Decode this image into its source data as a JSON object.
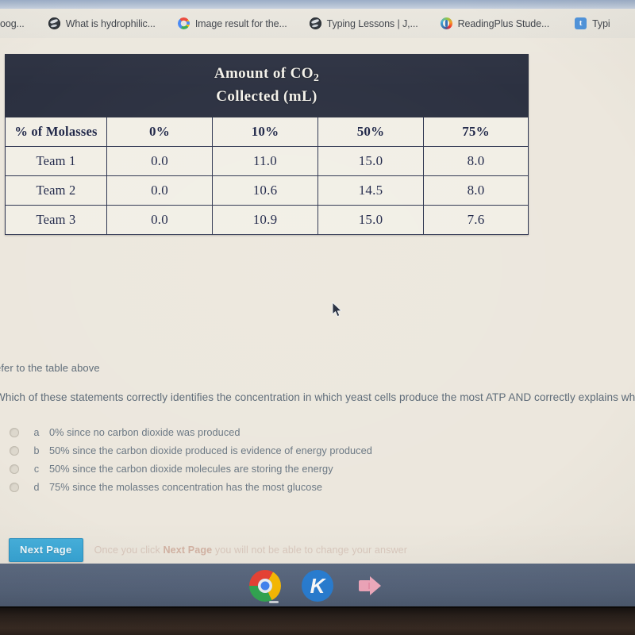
{
  "browser": {
    "bookmarks": [
      {
        "label": "oog...",
        "icon": "globe-icon"
      },
      {
        "label": "What is hydrophilic...",
        "icon": "globe-icon"
      },
      {
        "label": "Image result for the...",
        "icon": "google-g-icon"
      },
      {
        "label": "Typing Lessons | J,...",
        "icon": "globe-icon"
      },
      {
        "label": "ReadingPlus Stude...",
        "icon": "readingplus-icon"
      },
      {
        "label": "Typi",
        "icon": "typing-t-icon"
      }
    ]
  },
  "table": {
    "title_line1": "Amount of CO",
    "title_sub": "2",
    "title_line2": "Collected (mL)",
    "header": [
      "% of Molasses",
      "0%",
      "10%",
      "50%",
      "75%"
    ],
    "rows": [
      {
        "label": "Team 1",
        "values": [
          "0.0",
          "11.0",
          "15.0",
          "8.0"
        ]
      },
      {
        "label": "Team 2",
        "values": [
          "0.0",
          "10.6",
          "14.5",
          "8.0"
        ]
      },
      {
        "label": "Team 3",
        "values": [
          "0.0",
          "10.9",
          "15.0",
          "7.6"
        ]
      }
    ]
  },
  "question": {
    "refer_line": "efer to the table above",
    "prompt": "Which of these statements correctly identifies the concentration in which yeast cells produce the most ATP AND correctly explains why?",
    "options": [
      {
        "letter": "a",
        "text": "0% since no carbon dioxide was produced"
      },
      {
        "letter": "b",
        "text": "50% since the carbon dioxide produced is evidence of energy produced"
      },
      {
        "letter": "c",
        "text": "50% since the carbon dioxide molecules are storing the energy"
      },
      {
        "letter": "d",
        "text": "75% since the molasses concentration has the most glucose"
      }
    ]
  },
  "footer": {
    "next_button": "Next Page",
    "warning_pre": "Once you click ",
    "warning_strong": "Next Page",
    "warning_post": " you will not be able to change your answer"
  },
  "shelf": {
    "icons": [
      {
        "name": "chrome-icon",
        "label": ""
      },
      {
        "name": "kami-icon",
        "label": "K"
      },
      {
        "name": "screencast-icon",
        "label": ""
      }
    ]
  },
  "colors": {
    "page_background": "#ece7dd",
    "table_header_bg": "#2b3040",
    "table_text": "#1d2445",
    "next_button_bg": "#37a4d4",
    "shelf_bg": "#56647b",
    "kami_blue": "#2a7fd4",
    "cast_pink": "#f3a8bd"
  }
}
